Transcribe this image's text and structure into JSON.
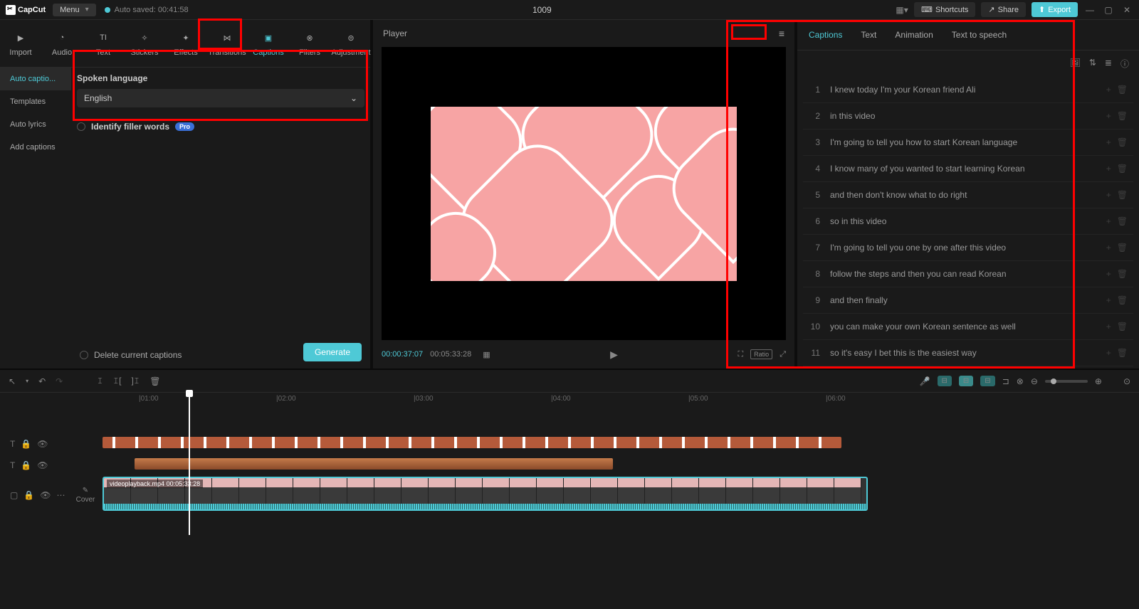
{
  "titlebar": {
    "logo": "CapCut",
    "menu": "Menu",
    "autosave": "Auto saved: 00:41:58",
    "project_title": "1009",
    "shortcuts": "Shortcuts",
    "share": "Share",
    "export": "Export"
  },
  "toolbar": {
    "items": [
      {
        "label": "Import",
        "icon": "▶"
      },
      {
        "label": "Audio",
        "icon": "◔"
      },
      {
        "label": "Text",
        "icon": "TI"
      },
      {
        "label": "Stickers",
        "icon": "✧"
      },
      {
        "label": "Effects",
        "icon": "✦"
      },
      {
        "label": "Transitions",
        "icon": "⋈"
      },
      {
        "label": "Captions",
        "icon": "▣",
        "active": true
      },
      {
        "label": "Filters",
        "icon": "⊗"
      },
      {
        "label": "Adjustment",
        "icon": "⊜"
      }
    ]
  },
  "side_tabs": [
    "Auto captio...",
    "Templates",
    "Auto lyrics",
    "Add captions"
  ],
  "options": {
    "spoken_label": "Spoken language",
    "language": "English",
    "filler_label": "Identify filler words",
    "pro_badge": "Pro",
    "delete_label": "Delete current captions",
    "generate": "Generate"
  },
  "player": {
    "title": "Player",
    "time_current": "00:00:37:07",
    "time_total": "00:05:33:28",
    "ratio_label": "Ratio"
  },
  "right_panel": {
    "tabs": [
      "Captions",
      "Text",
      "Animation",
      "Text to speech"
    ],
    "captions": [
      "I knew today I'm your Korean friend Ali",
      "in this video",
      "I'm going to tell you how to start Korean language",
      "I know many of you wanted to start learning Korean",
      "and then don't know what to do right",
      "so in this video",
      "I'm going to tell you one by one after this video",
      "follow the steps and then you can read Korean",
      "and then finally",
      "you can make your own Korean sentence as well",
      "so it's easy I bet this is the easiest way"
    ]
  },
  "timeline": {
    "ticks": [
      "01:00",
      "02:00",
      "03:00",
      "04:00",
      "05:00",
      "06:00"
    ],
    "clip_name": "videoplayback.mp4",
    "clip_duration": "00:05:33:28",
    "cover_label": "Cover"
  }
}
